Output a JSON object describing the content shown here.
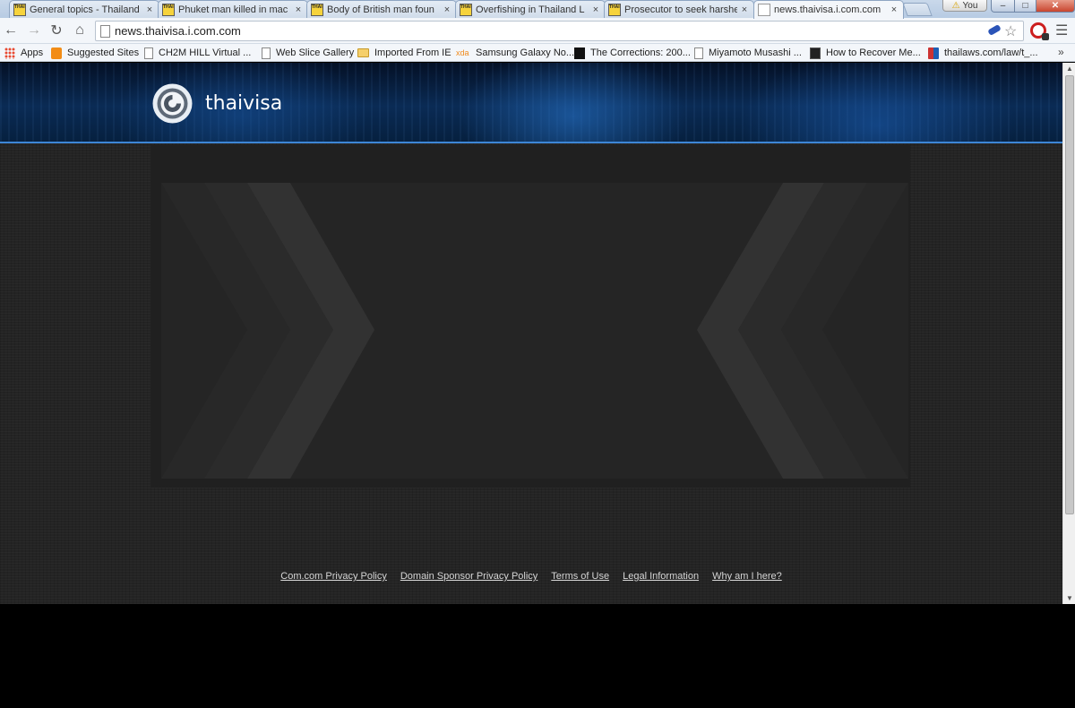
{
  "browser": {
    "tabs": [
      {
        "label": "General topics - Thailand",
        "favicon": "thaivisa-favicon"
      },
      {
        "label": "Phuket man killed in mac",
        "favicon": "thaivisa-favicon"
      },
      {
        "label": "Body of British man foun",
        "favicon": "thaivisa-favicon"
      },
      {
        "label": "Overfishing in Thailand L",
        "favicon": "thaivisa-favicon"
      },
      {
        "label": "Prosecutor to seek harshe",
        "favicon": "thaivisa-favicon"
      },
      {
        "label": "news.thaivisa.i.com.com",
        "favicon": "page-icon",
        "active": true
      }
    ],
    "favicon_text": "THAI VISA",
    "profile_label": "You",
    "window_buttons": {
      "minimize": "–",
      "maximize": "□",
      "close": "✕"
    },
    "address": "news.thaivisa.i.com.com",
    "bookmarks": [
      {
        "label": "Apps",
        "icon": "apps-grid-icon"
      },
      {
        "label": "Suggested Sites",
        "icon": "suggested-sites-icon"
      },
      {
        "label": "CH2M HILL Virtual ...",
        "icon": "page-icon"
      },
      {
        "label": "Web Slice Gallery",
        "icon": "page-icon"
      },
      {
        "label": "Imported From IE",
        "icon": "folder-icon"
      },
      {
        "label": "Samsung Galaxy No...",
        "icon": "xda-icon",
        "icon_text": "xda"
      },
      {
        "label": "The Corrections: 200...",
        "icon": "corrections-icon"
      },
      {
        "label": "Miyamoto Musashi ...",
        "icon": "page-icon"
      },
      {
        "label": "How to Recover Me...",
        "icon": "howto-icon"
      },
      {
        "label": "thailaws.com/law/t_...",
        "icon": "thailaws-icon"
      }
    ],
    "bookmarks_more": "»"
  },
  "page": {
    "site_name": "thaivisa",
    "colors": {
      "header_accent": "#3d86d6",
      "chevron": "#2e2e2e",
      "background": "#242424"
    },
    "footer_links": [
      "Com.com Privacy Policy",
      "Domain Sponsor Privacy Policy",
      "Terms of Use",
      "Legal Information",
      "Why am I here?"
    ]
  }
}
